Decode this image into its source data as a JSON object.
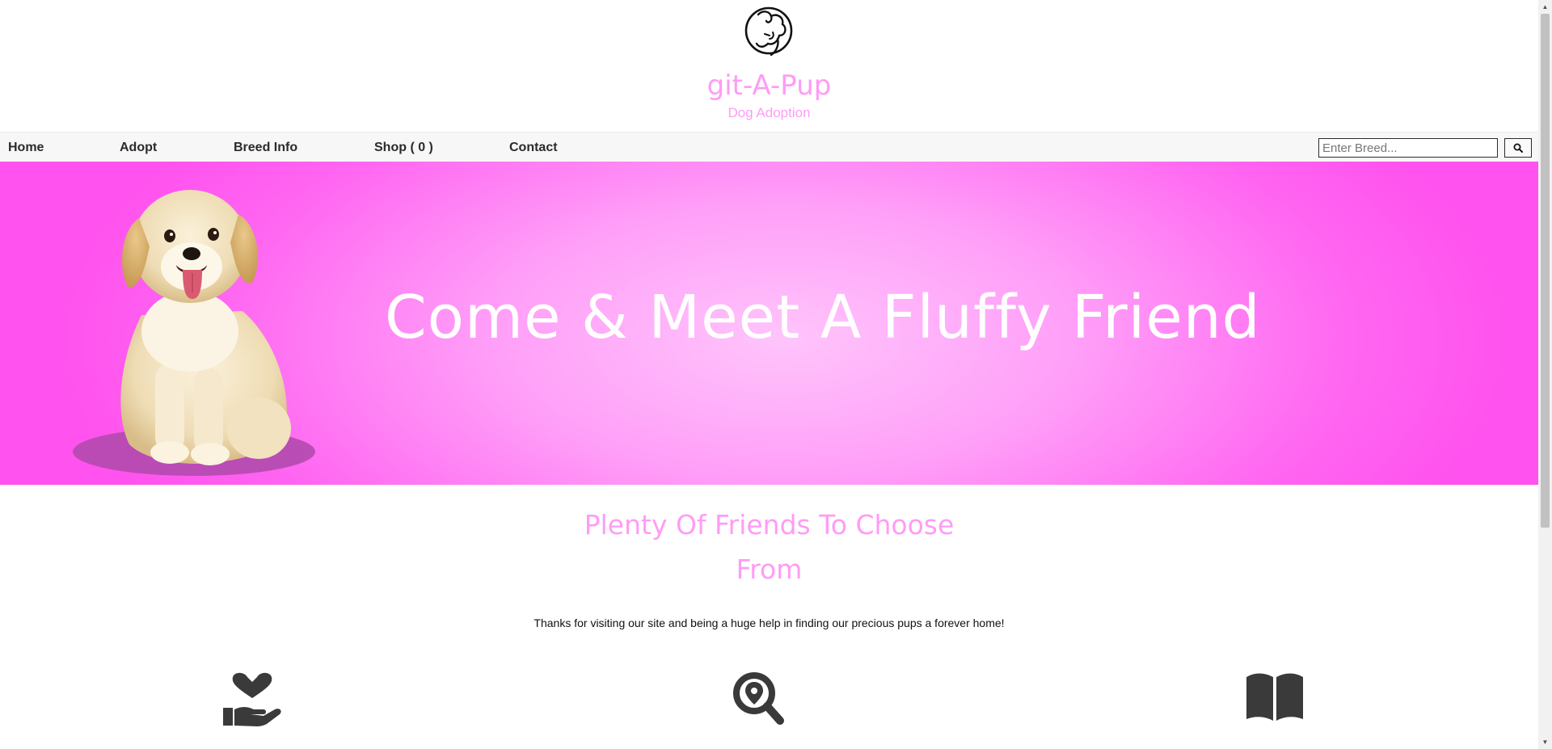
{
  "brand": {
    "title": "git-A-Pup",
    "subtitle": "Dog Adoption",
    "logo_icon": "dog-logo-icon",
    "color": "#ff9cf5"
  },
  "nav": {
    "items": [
      {
        "label": "Home"
      },
      {
        "label": "Adopt"
      },
      {
        "label": "Breed Info"
      },
      {
        "label": "Shop ( 0 )"
      },
      {
        "label": "Contact"
      }
    ],
    "search_placeholder": "Enter Breed...",
    "search_icon": "search-icon"
  },
  "hero": {
    "title": "Come & Meet A Fluffy Friend",
    "image": "puppy-image",
    "accent": "#ff66f1"
  },
  "section": {
    "title_line1": "Plenty Of Friends To Choose",
    "title_line2": "From",
    "text": "Thanks for visiting our site and being a huge help in finding our precious pups a forever home!"
  },
  "features": [
    {
      "icon": "hand-heart-icon"
    },
    {
      "icon": "location-search-icon"
    },
    {
      "icon": "book-icon"
    }
  ]
}
